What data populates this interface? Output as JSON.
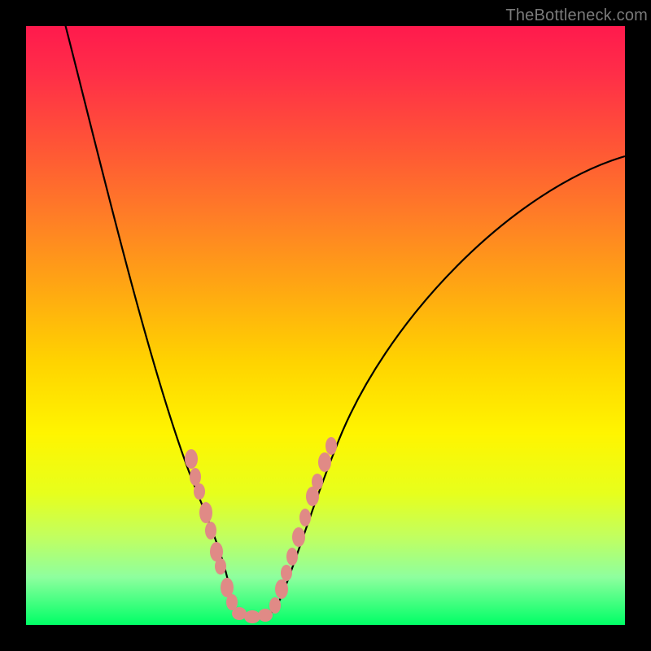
{
  "watermark": "TheBottleneck.com",
  "chart_data": {
    "type": "line",
    "title": "",
    "xlabel": "",
    "ylabel": "",
    "xlim": [
      0,
      100
    ],
    "ylim": [
      0,
      100
    ],
    "legend": false,
    "grid": false,
    "background_gradient": {
      "top_color": "#ff1a4d",
      "mid_color": "#fff500",
      "bottom_color": "#00ff66",
      "meaning": "red = high bottleneck, green = no bottleneck"
    },
    "series": [
      {
        "name": "bottleneck-left-branch",
        "stroke": "#000000",
        "x": [
          6,
          10,
          15,
          20,
          24,
          28,
          30,
          32,
          34,
          36,
          38
        ],
        "y": [
          100,
          82,
          60,
          42,
          30,
          22,
          15,
          10,
          6,
          3,
          1
        ]
      },
      {
        "name": "bottleneck-right-branch",
        "stroke": "#000000",
        "x": [
          38,
          40,
          42,
          45,
          48,
          52,
          58,
          66,
          76,
          88,
          100
        ],
        "y": [
          1,
          3,
          6,
          12,
          20,
          30,
          42,
          55,
          66,
          74,
          78
        ]
      }
    ],
    "markers": [
      {
        "name": "highlighted-region-beads",
        "shape": "ellipse",
        "color": "#e08a86",
        "points": [
          {
            "x": 27,
            "y": 28
          },
          {
            "x": 28,
            "y": 25
          },
          {
            "x": 29,
            "y": 22
          },
          {
            "x": 30,
            "y": 19
          },
          {
            "x": 31,
            "y": 16
          },
          {
            "x": 32,
            "y": 12
          },
          {
            "x": 33,
            "y": 10
          },
          {
            "x": 34,
            "y": 6
          },
          {
            "x": 35,
            "y": 4
          },
          {
            "x": 36,
            "y": 2
          },
          {
            "x": 38,
            "y": 1
          },
          {
            "x": 40,
            "y": 2
          },
          {
            "x": 42,
            "y": 4
          },
          {
            "x": 43,
            "y": 6
          },
          {
            "x": 44,
            "y": 9
          },
          {
            "x": 45,
            "y": 12
          },
          {
            "x": 46,
            "y": 15
          },
          {
            "x": 47,
            "y": 18
          },
          {
            "x": 48,
            "y": 22
          },
          {
            "x": 49,
            "y": 24
          },
          {
            "x": 50,
            "y": 27
          },
          {
            "x": 51,
            "y": 30
          }
        ]
      }
    ],
    "annotations": []
  }
}
